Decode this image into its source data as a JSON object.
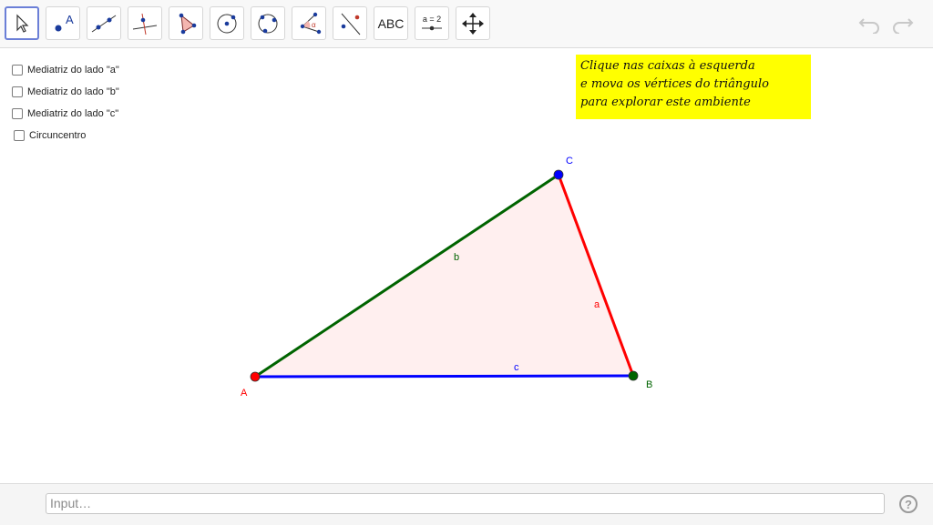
{
  "toolbar": {
    "tools": [
      {
        "name": "move-tool"
      },
      {
        "name": "point-tool",
        "glyph": "A"
      },
      {
        "name": "line-tool"
      },
      {
        "name": "perpendicular-line-tool"
      },
      {
        "name": "polygon-tool"
      },
      {
        "name": "circle-center-point-tool"
      },
      {
        "name": "circle-through-three-points-tool"
      },
      {
        "name": "angle-tool",
        "glyph": "α"
      },
      {
        "name": "reflect-about-line-tool"
      },
      {
        "name": "text-tool",
        "label": "ABC"
      },
      {
        "name": "slider-tool",
        "label": "a = 2"
      },
      {
        "name": "move-graphics-view-tool"
      }
    ],
    "undo_icon": "undo-icon",
    "redo_icon": "redo-icon"
  },
  "checkboxes": [
    {
      "label": "Mediatriz do lado \"a\"",
      "checked": false
    },
    {
      "label": "Mediatriz do lado \"b\"",
      "checked": false
    },
    {
      "label": "Mediatriz do lado \"c\"",
      "checked": false
    },
    {
      "label": "Circuncentro",
      "checked": false
    }
  ],
  "note": {
    "lines": [
      "Clique nas caixas à esquerda",
      "e mova os vértices do triângulo",
      "para explorar este ambiente"
    ],
    "background": "#ffff00"
  },
  "triangle": {
    "vertices": {
      "A": "A",
      "B": "B",
      "C": "C"
    },
    "sides": {
      "a": "a",
      "b": "b",
      "c": "c"
    },
    "colors": {
      "A": "#ff0000",
      "B": "#006400",
      "C": "#0000ff",
      "side_a": "#ff0000",
      "side_b": "#006400",
      "side_c": "#0000ff",
      "fill": "#ffe8e8"
    }
  },
  "input_bar": {
    "placeholder": "Input…"
  },
  "help_icon": "?"
}
